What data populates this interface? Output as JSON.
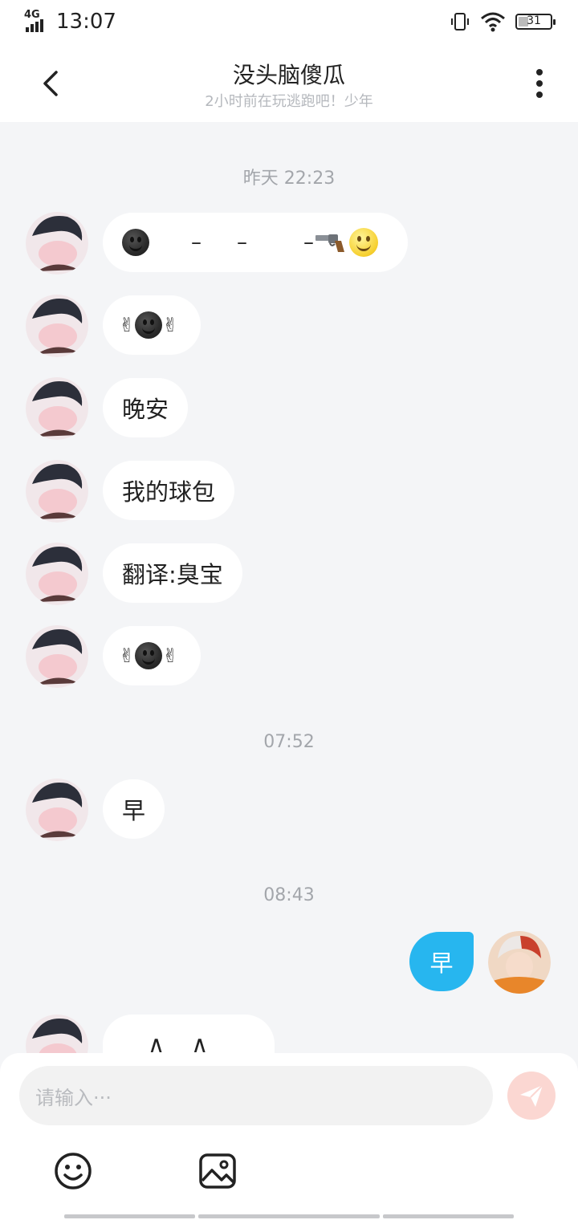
{
  "status_bar": {
    "network": "4G",
    "time": "13:07",
    "battery": "31",
    "battery_level": 0.31
  },
  "header": {
    "title": "没头脑傻瓜",
    "subtitle": "2小时前在玩逃跑吧！少年"
  },
  "timestamps": {
    "t1": "昨天 22:23",
    "t2": "07:52",
    "t3": "08:43"
  },
  "messages": {
    "m1": {
      "sender": "other",
      "sep1": "–",
      "sep2": "–",
      "sep3": "–",
      "icons": [
        "dark-smiley-icon",
        "revolver-icon",
        "smiley-icon"
      ]
    },
    "m2": {
      "sender": "other",
      "hand": "✌",
      "icons": [
        "victory-hand-icon",
        "dark-smiley-icon",
        "victory-hand-icon"
      ]
    },
    "m3": {
      "sender": "other",
      "text": "晚安"
    },
    "m4": {
      "sender": "other",
      "text": "我的球包"
    },
    "m5": {
      "sender": "other",
      "text": "翻译:臭宝"
    },
    "m6": {
      "sender": "other",
      "hand": "✌",
      "icons": [
        "victory-hand-icon",
        "dark-smiley-icon",
        "victory-hand-icon"
      ]
    },
    "m7": {
      "sender": "other",
      "text": "早"
    },
    "m8": {
      "sender": "me",
      "text": "早"
    },
    "m9": {
      "sender": "other",
      "text": "∧ _ ∧"
    }
  },
  "composer": {
    "placeholder": "请输入···",
    "icons": [
      "send-icon",
      "emoji-icon",
      "image-icon"
    ]
  },
  "colors": {
    "accent": "#27b6ef",
    "background": "#f4f5f7",
    "send_button": "#fbd7d2"
  }
}
